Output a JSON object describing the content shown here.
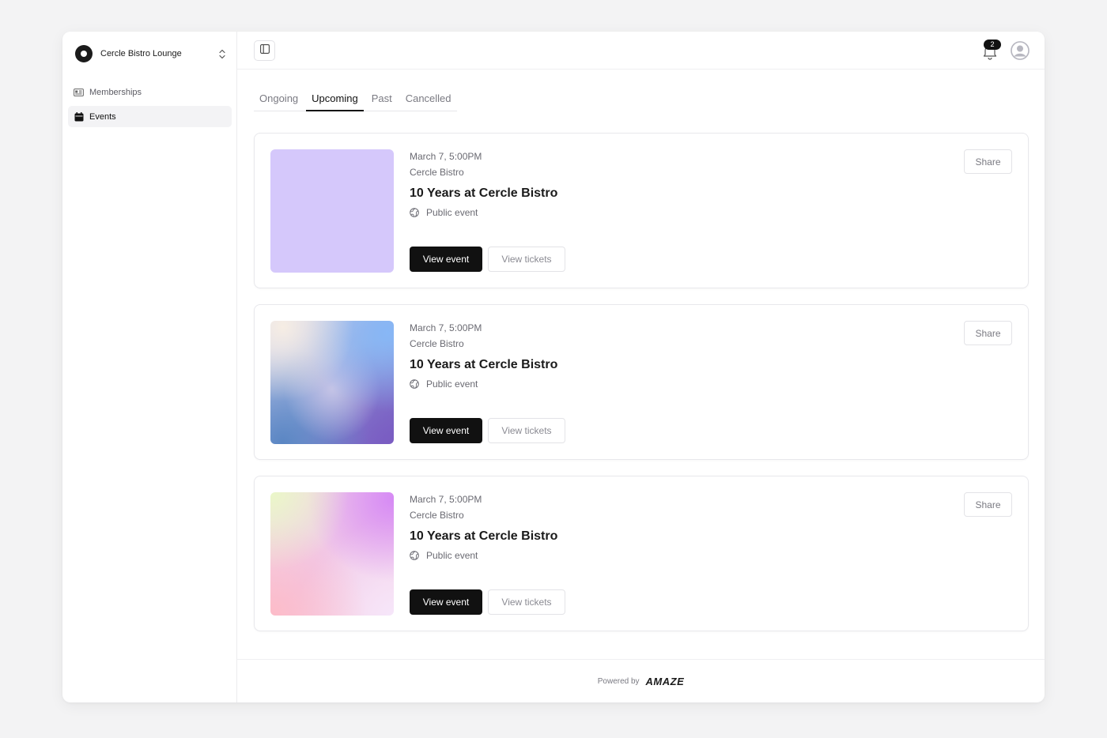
{
  "brand": {
    "name": "Cercle Bistro Lounge"
  },
  "sidebar": {
    "items": [
      {
        "label": "Memberships",
        "icon": "id-card-icon"
      },
      {
        "label": "Events",
        "icon": "calendar-icon"
      }
    ]
  },
  "topbar": {
    "notification_count": "2"
  },
  "tabs": [
    {
      "label": "Ongoing"
    },
    {
      "label": "Upcoming"
    },
    {
      "label": "Past"
    },
    {
      "label": "Cancelled"
    }
  ],
  "active_tab": "Upcoming",
  "events": [
    {
      "date": "March 7, 5:00PM",
      "venue": "Cercle Bistro",
      "title": "10 Years at Cercle Bistro",
      "visibility": "Public event",
      "view_label": "View event",
      "tickets_label": "View tickets",
      "share_label": "Share"
    },
    {
      "date": "March 7, 5:00PM",
      "venue": "Cercle Bistro",
      "title": "10 Years at Cercle Bistro",
      "visibility": "Public event",
      "view_label": "View event",
      "tickets_label": "View tickets",
      "share_label": "Share"
    },
    {
      "date": "March 7, 5:00PM",
      "venue": "Cercle Bistro",
      "title": "10 Years at Cercle Bistro",
      "visibility": "Public event",
      "view_label": "View event",
      "tickets_label": "View tickets",
      "share_label": "Share"
    }
  ],
  "footer": {
    "powered_by": "Powered by",
    "logo": "AMAZE"
  },
  "colors": {
    "accent": "#111111",
    "background": "#f3f3f4"
  }
}
